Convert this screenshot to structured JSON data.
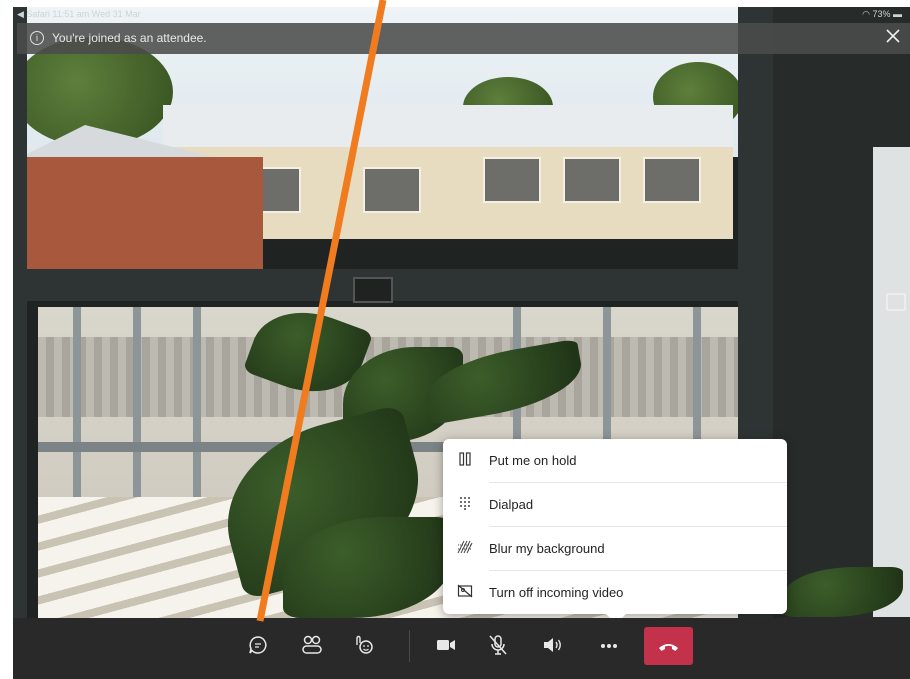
{
  "status_bar": {
    "left": "◀ Safari  11:51 am  Wed 31 Mar",
    "battery": "73%"
  },
  "banner": {
    "message": "You're joined as an attendee."
  },
  "more_menu": {
    "items": [
      {
        "label": "Put me on hold",
        "icon": "pause-icon"
      },
      {
        "label": "Dialpad",
        "icon": "dialpad-icon"
      },
      {
        "label": "Blur my background",
        "icon": "blur-background-icon"
      },
      {
        "label": "Turn off incoming video",
        "icon": "video-off-icon"
      }
    ]
  },
  "toolbar": {
    "buttons": [
      "chat-icon",
      "participants-icon",
      "reactions-icon",
      "camera-icon",
      "mute-microphone-icon",
      "speaker-icon",
      "more-options-icon",
      "hang-up-icon"
    ]
  },
  "colors": {
    "hang_up": "#c4314b",
    "annotation_line": "#f07c1f",
    "toolbar_bg": "#292929"
  }
}
